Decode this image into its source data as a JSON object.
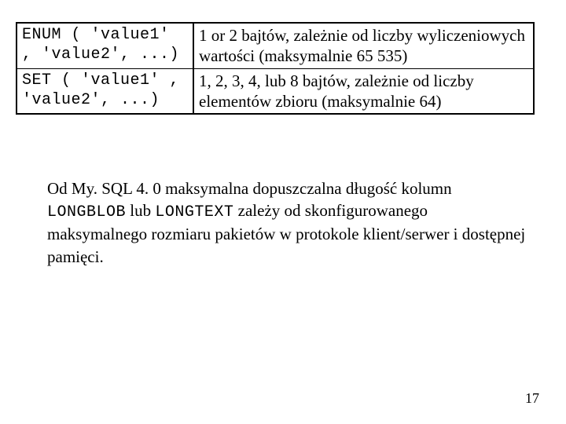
{
  "table": {
    "rows": [
      {
        "type": "ENUM ( 'value1' , 'value2', ...)",
        "desc": "1 or 2 bajtów, zależnie od liczby wyliczeniowych wartości (maksymalnie 65 535)"
      },
      {
        "type": "SET ( 'value1' , 'value2', ...)",
        "desc": "1, 2, 3, 4, lub 8 bajtów, zależnie od liczby elementów zbioru (maksymalnie 64)"
      }
    ]
  },
  "paragraph": {
    "part1": "Od My. SQL 4. 0 maksymalna dopuszczalna długość kolumn ",
    "code1": "LONGBLOB",
    "part2": " lub ",
    "code2": "LONGTEXT",
    "part3": " zależy od skonfigurowanego maksymalnego rozmiaru pakietów w protokole klient/serwer i dostępnej pamięci."
  },
  "page_number": "17"
}
